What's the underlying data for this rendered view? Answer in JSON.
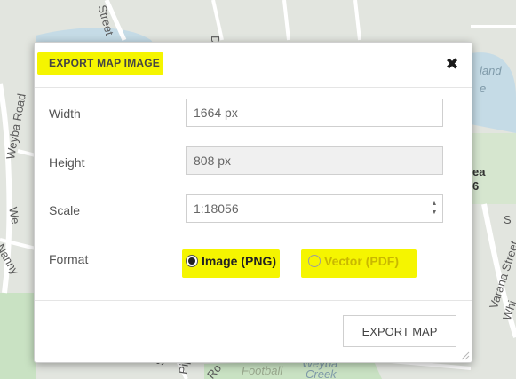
{
  "map": {
    "labels": {
      "weyba_road": "Weyba Road",
      "street_top": "Street",
      "nanny": "Nanny",
      "island": "land",
      "island_e": "e",
      "varana_street": "Varana Street",
      "ea": "ea",
      "six": "6",
      "weyba_creek_1": "Weyba",
      "weyba_creek_2": "Creek",
      "football": "Football",
      "whi": "Whi",
      "s_letter": "S",
      "pip": "Pip",
      "we": "We",
      "ro": "Ro",
      "d_letter": "D",
      "s_right": "S"
    }
  },
  "dialog": {
    "title": "EXPORT MAP IMAGE",
    "close_icon": "✖",
    "fields": {
      "width": {
        "label": "Width",
        "value": "1664 px"
      },
      "height": {
        "label": "Height",
        "value": "808 px"
      },
      "scale": {
        "label": "Scale",
        "value": "1:18056",
        "spinner_up": "▲",
        "spinner_down": "▼"
      }
    },
    "format": {
      "label": "Format",
      "options": [
        {
          "label": "Image (PNG)",
          "selected": true
        },
        {
          "label": "Vector (PDF)",
          "selected": false
        }
      ]
    },
    "export_button": "EXPORT MAP"
  },
  "colors": {
    "highlight": "#f5f500",
    "map_water": "#c5dbe6",
    "map_park": "#c9e2c3"
  }
}
